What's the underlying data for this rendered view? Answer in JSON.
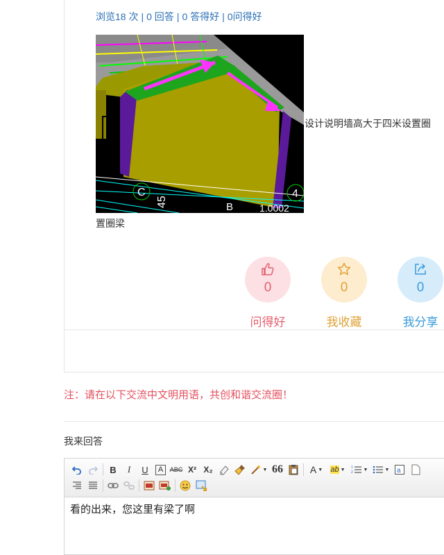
{
  "post": {
    "meta": {
      "views": "浏览18 次",
      "answers": "0 回答",
      "good_answers": "0 答得好",
      "good_questions": "0问得好",
      "separator": "|"
    },
    "body_inline": "设计说明墙高大于四米设置圈",
    "body_wrap": "置圈梁",
    "image_labels": {
      "c_mark": "C",
      "num_45": "45",
      "num_4": "4",
      "b_mark": "B",
      "code": "1.0002"
    }
  },
  "actions": [
    {
      "id": "good",
      "count": "0",
      "label": "问得好",
      "icon": "thumbs-up-icon"
    },
    {
      "id": "fav",
      "count": "0",
      "label": "我收藏",
      "icon": "star-icon"
    },
    {
      "id": "share",
      "count": "0",
      "label": "我分享",
      "icon": "share-icon"
    }
  ],
  "notice": "注：请在以下交流中文明用语，共创和谐交流圈！",
  "answer_section": {
    "title": "我来回答"
  },
  "editor": {
    "content": "看的出来，您这里有梁了啊",
    "toolbar": {
      "bold": "B",
      "italic": "I",
      "underline": "U",
      "font_color": "A",
      "strike": "ABC",
      "superscript": "X²",
      "subscript": "X₂",
      "quote": "66",
      "font_size": "A",
      "highlight": "ab"
    }
  },
  "colors": {
    "link": "#2a6fb5",
    "notice_red": "#e4505f",
    "good": "#e4606d",
    "fav": "#e0a23a",
    "share": "#3a9bd9"
  }
}
